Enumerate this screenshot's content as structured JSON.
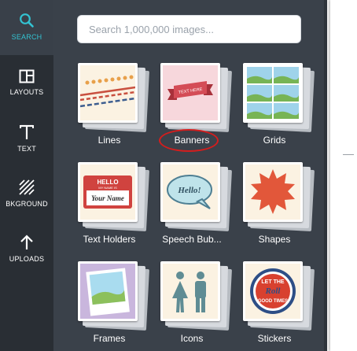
{
  "sidebar": {
    "items": [
      {
        "label": "SEARCH",
        "icon": "search-icon",
        "active": true
      },
      {
        "label": "LAYOUTS",
        "icon": "layouts-icon",
        "active": false
      },
      {
        "label": "TEXT",
        "icon": "text-icon",
        "active": false
      },
      {
        "label": "BKGROUND",
        "icon": "background-icon",
        "active": false
      },
      {
        "label": "UPLOADS",
        "icon": "upload-icon",
        "active": false
      }
    ]
  },
  "search": {
    "placeholder": "Search 1,000,000 images...",
    "value": ""
  },
  "categories": [
    {
      "label": "Lines",
      "icon": "lines-icon"
    },
    {
      "label": "Banners",
      "icon": "banner-icon",
      "highlighted": true
    },
    {
      "label": "Grids",
      "icon": "grid-icon"
    },
    {
      "label": "Text Holders",
      "icon": "text-holder-icon",
      "art_text": [
        "HELLO",
        "MY NAME IS",
        "Your Name"
      ]
    },
    {
      "label": "Speech Bub...",
      "icon": "speech-bubble-icon",
      "art_text": [
        "Hello!"
      ]
    },
    {
      "label": "Shapes",
      "icon": "shape-icon"
    },
    {
      "label": "Frames",
      "icon": "frame-icon"
    },
    {
      "label": "Icons",
      "icon": "people-icon"
    },
    {
      "label": "Stickers",
      "icon": "sticker-icon",
      "art_text": [
        "LET THE",
        "Roll",
        "GOOD TIMES"
      ]
    }
  ],
  "banner_art_text": "TEXT HERE",
  "colors": {
    "sidebar_bg": "#292e34",
    "panel_bg": "#3a414a",
    "accent": "#33c3d2",
    "highlight_marker": "#d41d1d"
  }
}
